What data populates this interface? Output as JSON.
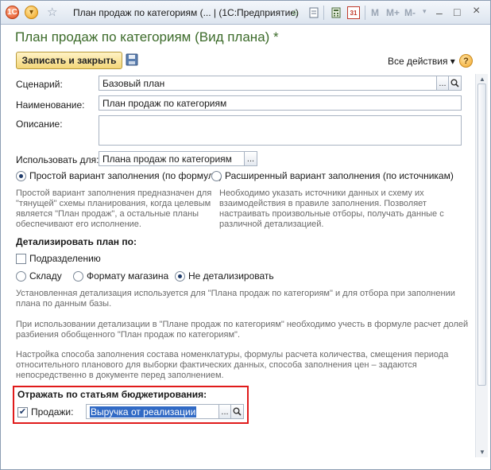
{
  "titlebar": {
    "title": "План продаж по категориям (... | (1С:Предприятие)",
    "m_label": "M",
    "m_plus_label": "M+",
    "m_minus_label": "M-",
    "calendar_day": "31",
    "minimize": "–",
    "restore": "□",
    "close": "×"
  },
  "header": {
    "title": "План продаж по категориям (Вид плана) *"
  },
  "toolbar": {
    "save_close_label": "Записать и закрыть",
    "all_actions_label": "Все действия ▾",
    "help_label": "?"
  },
  "form": {
    "scenario_label": "Сценарий:",
    "scenario_value": "Базовый план",
    "name_label": "Наименование:",
    "name_value": "План продаж по категориям",
    "description_label": "Описание:",
    "description_value": "",
    "use_for_label": "Использовать для:",
    "use_for_value": "Плана продаж по категориям",
    "dots": "...",
    "fill_simple_label": "Простой вариант заполнения (по формуле)",
    "fill_extended_label": "Расширенный вариант заполнения (по источникам)",
    "fill_simple_note": "Простой вариант заполнения предназначен для \"тянущей\" схемы планирования, когда целевым является \"План продаж\", а остальные планы обеспечивают его исполнение.",
    "fill_extended_note": "Необходимо указать источники данных и схему их взаимодействия в правиле заполнения. Позволяет настраивать произвольные отборы, получать данные с различной детализацией.",
    "detail_heading": "Детализировать план по:",
    "subdivision_label": "Подразделению",
    "warehouse_label": "Складу",
    "store_format_label": "Формату магазина",
    "no_detail_label": "Не детализировать",
    "note1": "Установленная детализация используется для \"Плана продаж по категориям\" и для отбора при заполнении плана по данным базы.",
    "note2": "При использовании детализации в \"Плане продаж по категориям\" необходимо учесть в формуле расчет долей разбиения обобщенного \"План продаж по категориям\".",
    "note3": "Настройка способа заполнения состава номенклатуры, формулы расчета количества, смещения периода относительного планового для выборки фактических данных, способа заполнения цен – задаются непосредственно в документе перед заполнением.",
    "budget_heading": "Отражать по статьям бюджетирования:",
    "sales_label": "Продажи:",
    "sales_value": "Выручка от реализации",
    "sales_checked": "✔"
  }
}
